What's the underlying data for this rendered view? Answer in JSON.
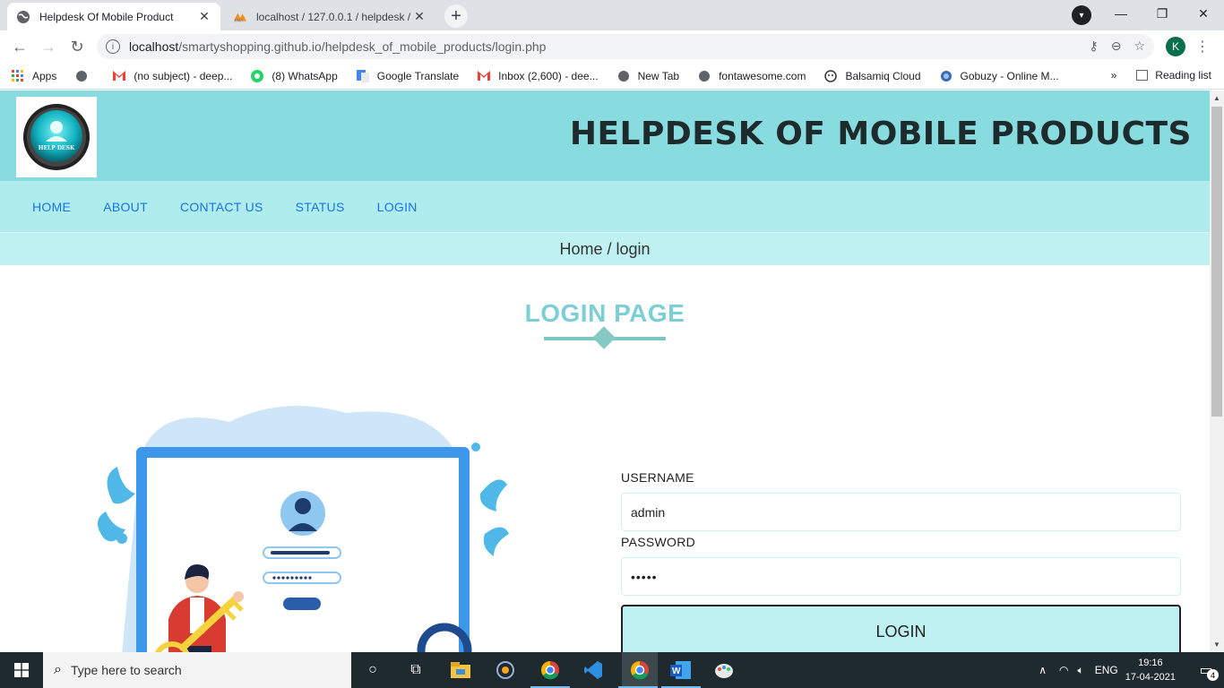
{
  "browser": {
    "tabs": [
      {
        "title": "Helpdesk Of Mobile Product",
        "active": true
      },
      {
        "title": "localhost / 127.0.0.1 / helpdesk /",
        "active": false
      }
    ],
    "url_host": "localhost",
    "url_path": "/smartyshopping.github.io/helpdesk_of_mobile_products/login.php",
    "profile_initial": "K",
    "bookmarks": [
      {
        "label": "Apps",
        "icon": "apps-grid-icon"
      },
      {
        "label": "(no subject) - deep...",
        "icon": "gmail-icon"
      },
      {
        "label": "(8) WhatsApp",
        "icon": "whatsapp-icon"
      },
      {
        "label": "Google Translate",
        "icon": "translate-icon"
      },
      {
        "label": "Inbox (2,600) - dee...",
        "icon": "gmail-icon"
      },
      {
        "label": "New Tab",
        "icon": "globe-icon"
      },
      {
        "label": "fontawesome.com",
        "icon": "globe-icon"
      },
      {
        "label": "Balsamiq Cloud",
        "icon": "balsamiq-icon"
      },
      {
        "label": "Gobuzy - Online M...",
        "icon": "gobuzy-icon"
      }
    ],
    "reading_list": "Reading list",
    "more_bookmarks": "»"
  },
  "site": {
    "title": "HELPDESK OF MOBILE PRODUCTS",
    "logo_text": "HELP DESK",
    "nav": [
      "HOME",
      "ABOUT",
      "CONTACT US",
      "STATUS",
      "LOGIN"
    ],
    "breadcrumb": "Home / login",
    "heading": "LOGIN PAGE",
    "form": {
      "username_label": "USERNAME",
      "username_value": "admin",
      "password_label": "PASSWORD",
      "password_value": "•••••",
      "submit_label": "LOGIN"
    }
  },
  "taskbar": {
    "search_placeholder": "Type here to search",
    "language": "ENG",
    "time": "19:16",
    "date": "17-04-2021",
    "notifications": "4"
  },
  "colors": {
    "header_bg": "#88dce0",
    "nav_bg": "#aeecee",
    "breadcrumb_bg": "#bff1f3",
    "heading": "#7dcfd6",
    "link": "#1a73e8"
  }
}
